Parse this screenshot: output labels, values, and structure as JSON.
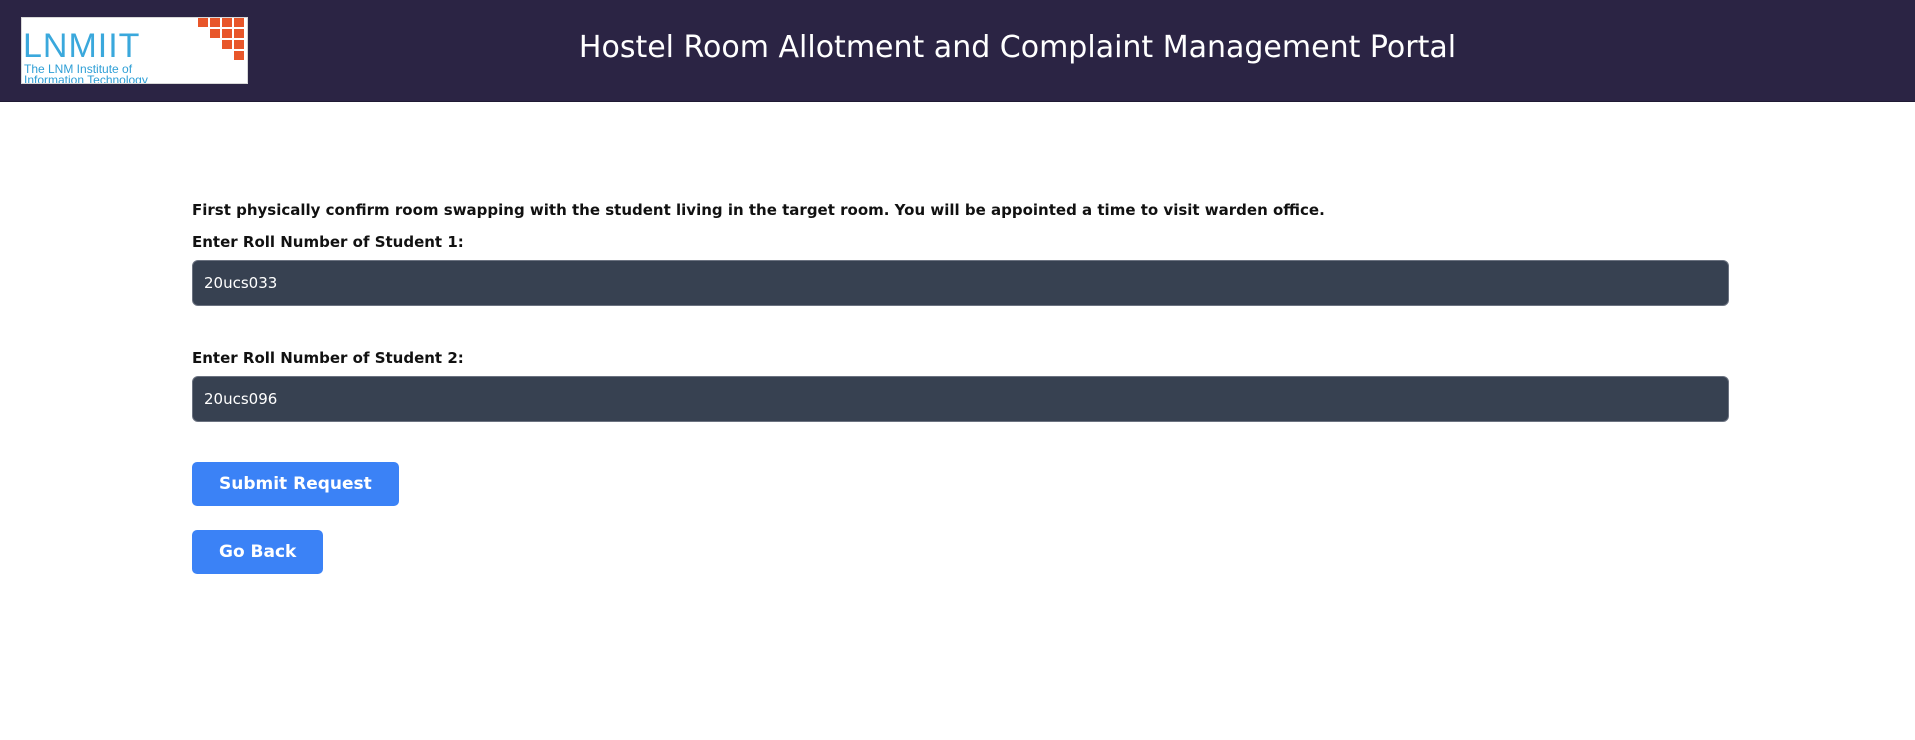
{
  "header": {
    "logo": {
      "title": "LNMIIT",
      "subtitle_line1": "The LNM Institute of",
      "subtitle_line2": "Information Technology",
      "accent_color": "#e8562a",
      "text_color": "#3aa8dc"
    },
    "title": "Hostel Room Allotment and Complaint Management Portal",
    "background_color": "#2b2444"
  },
  "form": {
    "note": "First physically confirm room swapping with the student living in the target room. You will be appointed a time to visit warden office.",
    "student1": {
      "label": "Enter Roll Number of Student 1:",
      "value": "20ucs033"
    },
    "student2": {
      "label": "Enter Roll Number of Student 2:",
      "value": "20ucs096"
    },
    "submit_label": "Submit Request",
    "back_label": "Go Back",
    "button_color": "#3b82f6",
    "input_color": "#374151"
  }
}
